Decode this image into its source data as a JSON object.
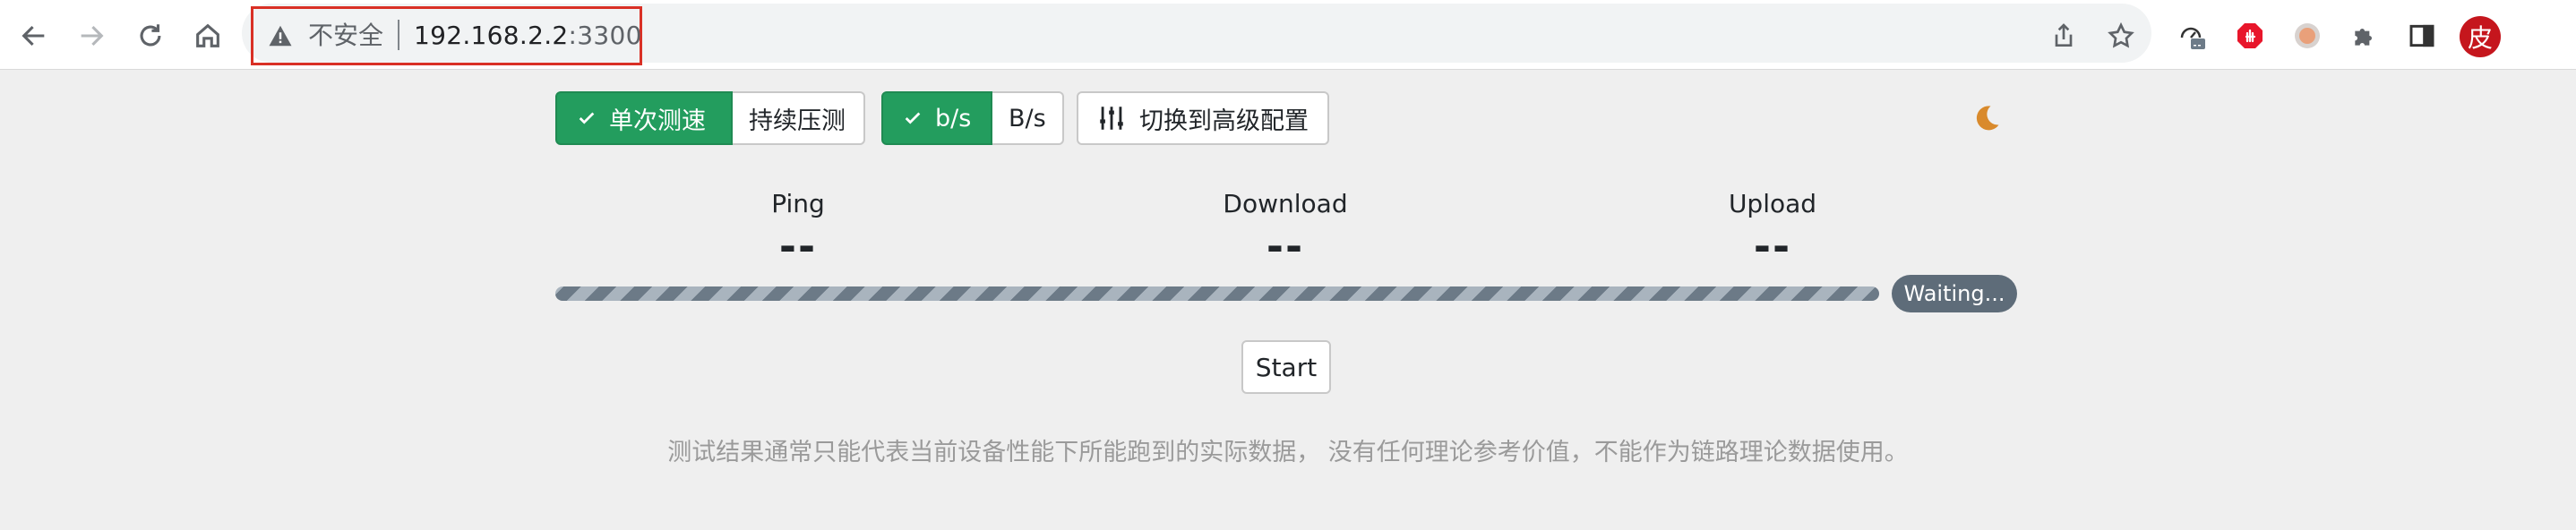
{
  "browser": {
    "security_label": "不安全",
    "url_host": "192.168.2.2",
    "url_port": ":3300",
    "avatar_char": "皮",
    "icons": [
      "back-icon",
      "forward-icon",
      "reload-icon",
      "home-icon",
      "share-icon",
      "bookmark-star-icon",
      "speedtest-extension-icon",
      "adblock-extension-icon",
      "extension-circle-icon",
      "puzzle-extensions-icon",
      "side-panel-icon"
    ]
  },
  "toolbar": {
    "mode_single": "单次测速",
    "mode_continuous": "持续压测",
    "unit_bits": "b/s",
    "unit_bytes": "B/s",
    "advanced_config": "切换到高级配置"
  },
  "metrics": {
    "ping": {
      "label": "Ping",
      "value": "--"
    },
    "download": {
      "label": "Download",
      "value": "--"
    },
    "upload": {
      "label": "Upload",
      "value": "--"
    }
  },
  "status": {
    "text": "Waiting..."
  },
  "start_label": "Start",
  "disclaimer": "测试结果通常只能代表当前设备性能下所能跑到的实际数据， 没有任何理论参考价值，不能作为链路理论数据使用。",
  "colors": {
    "accent": "#239d5e",
    "badge": "#5e6c79",
    "moon": "#d98a2c",
    "warning_outline": "#d93025"
  }
}
